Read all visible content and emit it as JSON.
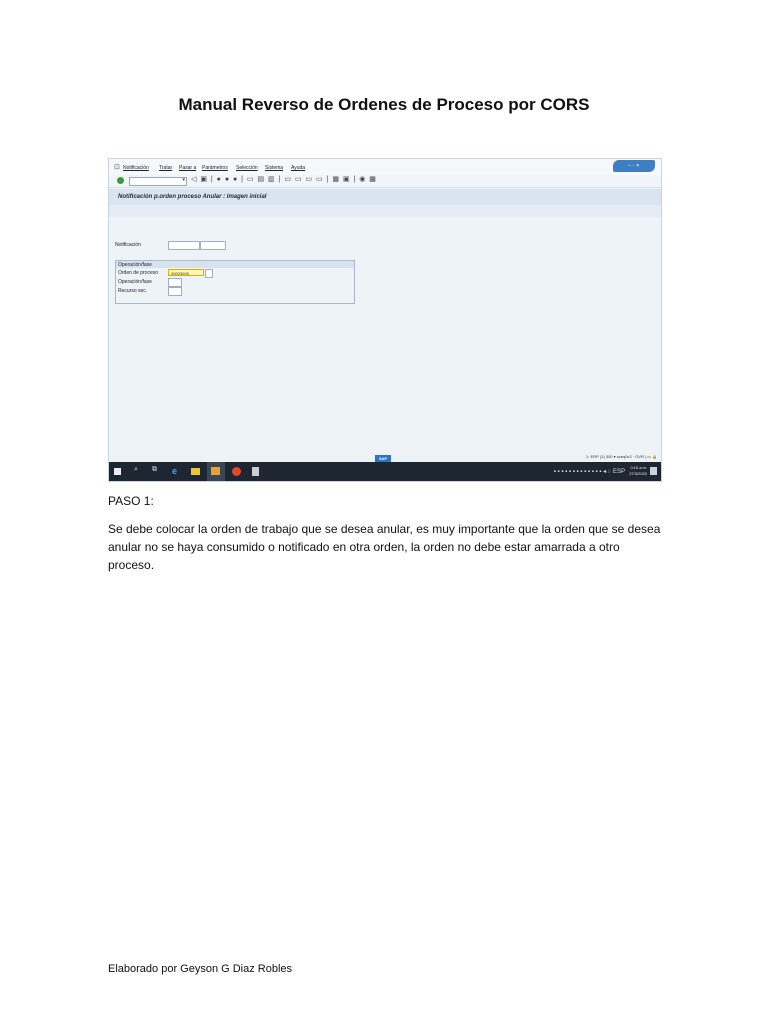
{
  "document": {
    "title": "Manual Reverso de Ordenes de Proceso por CORS",
    "step_label": "PASO 1:",
    "paragraph": " Se debe colocar la orden de trabajo que se desea anular, es muy importante que la orden que se desea anular no se haya consumido o notificado en otra orden, la orden no debe estar amarrada a otro proceso.",
    "footer": "Elaborado por Geyson G Diaz Robles"
  },
  "sap": {
    "menu": [
      "Notificación",
      "Tratar",
      "Pasar a",
      "Parámetros",
      "Selección",
      "Sistema",
      "Ayuda"
    ],
    "screen_title": "Notificación p.orden proceso Anular : Imagen inicial",
    "notificacion_label": "Notificación",
    "group_title": "Operación/fase",
    "orden_label": "Orden de proceso",
    "orden_value": "40003005",
    "operacion_label": "Operación/fase",
    "recurso_label": "Recurso sec.",
    "logo_text": "SAP",
    "status_text": "▷ ERP (1) 300 ▾  sceq0c3 · OVR  |  ▭  🔒",
    "clock_time": "0:16 a.m.",
    "clock_date": "27/3/2020",
    "tray_lang": "ESP"
  },
  "colors": {
    "accent": "#3e7ec2",
    "highlight_field": "#fff6b0",
    "taskbar": "#1e2632"
  }
}
